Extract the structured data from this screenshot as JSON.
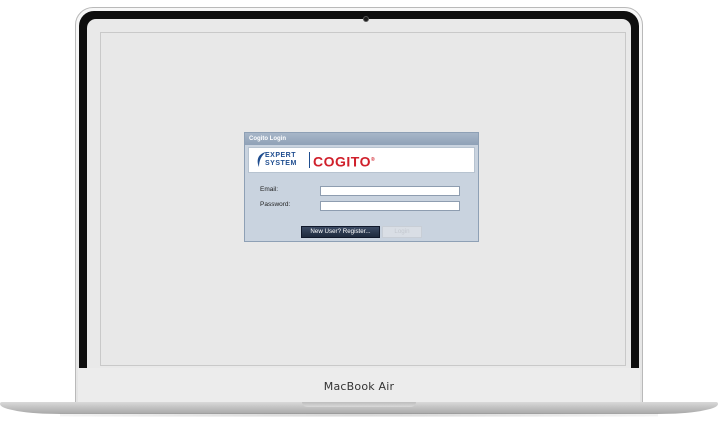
{
  "device": {
    "brand_label": "MacBook Air"
  },
  "dialog": {
    "title": "Cogito Login",
    "logo": {
      "expert_line1": "EXPERT",
      "expert_line2": "SYSTEM",
      "product": "COGITO",
      "product_mark": "®"
    },
    "fields": {
      "email_label": "Email:",
      "email_value": "",
      "password_label": "Password:",
      "password_value": ""
    },
    "buttons": {
      "register_label": "New User? Register...",
      "login_label": "Login"
    }
  },
  "colors": {
    "dialog_bg": "#c9d3df",
    "logo_red": "#d0202b",
    "logo_blue": "#1f4d8f",
    "register_button": "#1e2a3d"
  }
}
